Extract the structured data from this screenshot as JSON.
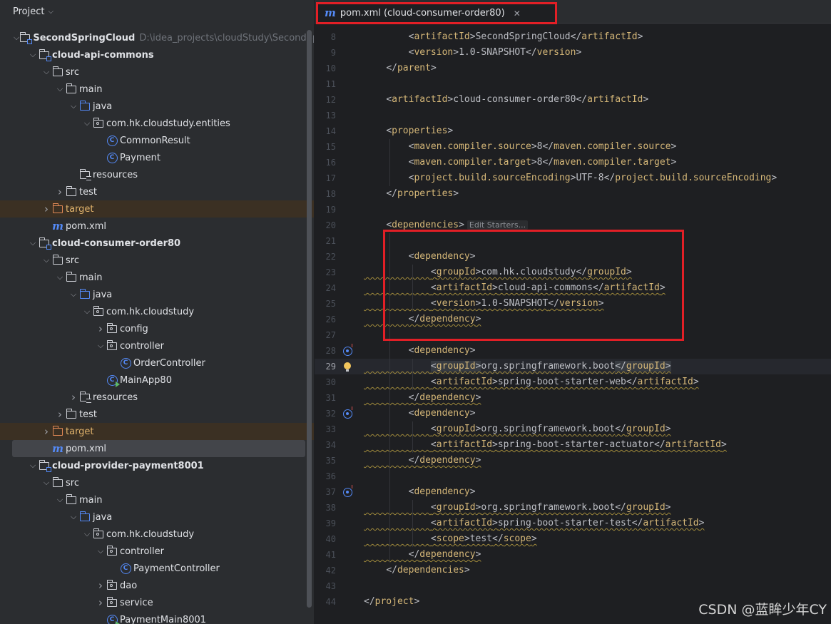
{
  "project_panel": {
    "title": "Project",
    "tree": [
      {
        "depth": 0,
        "arrow": "down",
        "icon": "module-folder-icon",
        "label": "SecondSpringCloud",
        "bold": true,
        "path": "D:\\idea_projects\\cloudStudy\\SecondSpringCloud"
      },
      {
        "depth": 1,
        "arrow": "down",
        "icon": "module-folder-icon",
        "label": "cloud-api-commons",
        "bold": true
      },
      {
        "depth": 2,
        "arrow": "down",
        "icon": "folder-icon",
        "label": "src"
      },
      {
        "depth": 3,
        "arrow": "down",
        "icon": "folder-icon",
        "label": "main"
      },
      {
        "depth": 4,
        "arrow": "down",
        "icon": "source-folder-icon",
        "label": "java"
      },
      {
        "depth": 5,
        "arrow": "down",
        "icon": "package-icon",
        "label": "com.hk.cloudstudy.entities"
      },
      {
        "depth": 6,
        "arrow": "none",
        "icon": "class-icon",
        "label": "CommonResult"
      },
      {
        "depth": 6,
        "arrow": "none",
        "icon": "class-icon",
        "label": "Payment"
      },
      {
        "depth": 4,
        "arrow": "none",
        "icon": "resources-folder-icon",
        "label": "resources"
      },
      {
        "depth": 3,
        "arrow": "right",
        "icon": "folder-icon",
        "label": "test"
      },
      {
        "depth": 2,
        "arrow": "right",
        "icon": "excluded-folder-icon",
        "label": "target",
        "highlight": "brown"
      },
      {
        "depth": 2,
        "arrow": "none",
        "icon": "maven-icon",
        "label": "pom.xml"
      },
      {
        "depth": 1,
        "arrow": "down",
        "icon": "module-folder-icon",
        "label": "cloud-consumer-order80",
        "bold": true
      },
      {
        "depth": 2,
        "arrow": "down",
        "icon": "folder-icon",
        "label": "src"
      },
      {
        "depth": 3,
        "arrow": "down",
        "icon": "folder-icon",
        "label": "main"
      },
      {
        "depth": 4,
        "arrow": "down",
        "icon": "source-folder-icon",
        "label": "java"
      },
      {
        "depth": 5,
        "arrow": "down",
        "icon": "package-icon",
        "label": "com.hk.cloudstudy"
      },
      {
        "depth": 6,
        "arrow": "right",
        "icon": "package-icon",
        "label": "config"
      },
      {
        "depth": 6,
        "arrow": "down",
        "icon": "package-icon",
        "label": "controller"
      },
      {
        "depth": 7,
        "arrow": "none",
        "icon": "class-icon",
        "label": "OrderController"
      },
      {
        "depth": 6,
        "arrow": "none",
        "icon": "spring-boot-class-icon",
        "label": "MainApp80"
      },
      {
        "depth": 4,
        "arrow": "right",
        "icon": "resources-folder-icon",
        "label": "resources"
      },
      {
        "depth": 3,
        "arrow": "right",
        "icon": "folder-icon",
        "label": "test"
      },
      {
        "depth": 2,
        "arrow": "right",
        "icon": "excluded-folder-icon",
        "label": "target",
        "highlight": "brown"
      },
      {
        "depth": 2,
        "arrow": "none",
        "icon": "maven-icon",
        "label": "pom.xml",
        "highlight": "gray"
      },
      {
        "depth": 1,
        "arrow": "down",
        "icon": "module-folder-icon",
        "label": "cloud-provider-payment8001",
        "bold": true
      },
      {
        "depth": 2,
        "arrow": "down",
        "icon": "folder-icon",
        "label": "src"
      },
      {
        "depth": 3,
        "arrow": "down",
        "icon": "folder-icon",
        "label": "main"
      },
      {
        "depth": 4,
        "arrow": "down",
        "icon": "source-folder-icon",
        "label": "java"
      },
      {
        "depth": 5,
        "arrow": "down",
        "icon": "package-icon",
        "label": "com.hk.cloudstudy"
      },
      {
        "depth": 6,
        "arrow": "down",
        "icon": "package-icon",
        "label": "controller"
      },
      {
        "depth": 7,
        "arrow": "none",
        "icon": "class-icon",
        "label": "PaymentController"
      },
      {
        "depth": 6,
        "arrow": "right",
        "icon": "package-icon",
        "label": "dao"
      },
      {
        "depth": 6,
        "arrow": "right",
        "icon": "package-icon",
        "label": "service"
      },
      {
        "depth": 6,
        "arrow": "none",
        "icon": "spring-boot-class-icon",
        "label": "PaymentMain8001"
      }
    ]
  },
  "editor": {
    "tab": {
      "icon": "maven-icon",
      "label": "pom.xml (cloud-consumer-order80)",
      "close_icon": "close-icon"
    },
    "current_line": 29,
    "lines": [
      {
        "n": 8,
        "indent": 2,
        "kind": "elem",
        "tag": "artifactId",
        "text": "SecondSpringCloud"
      },
      {
        "n": 9,
        "indent": 2,
        "kind": "elem",
        "tag": "version",
        "text": "1.0-SNAPSHOT"
      },
      {
        "n": 10,
        "indent": 1,
        "kind": "close",
        "tag": "parent"
      },
      {
        "n": 11,
        "kind": "blank"
      },
      {
        "n": 12,
        "indent": 1,
        "kind": "elem",
        "tag": "artifactId",
        "text": "cloud-consumer-order80"
      },
      {
        "n": 13,
        "kind": "blank"
      },
      {
        "n": 14,
        "indent": 1,
        "kind": "open",
        "tag": "properties"
      },
      {
        "n": 15,
        "indent": 2,
        "kind": "elem",
        "tag": "maven.compiler.source",
        "text": "8"
      },
      {
        "n": 16,
        "indent": 2,
        "kind": "elem",
        "tag": "maven.compiler.target",
        "text": "8"
      },
      {
        "n": 17,
        "indent": 2,
        "kind": "elem",
        "tag": "project.build.sourceEncoding",
        "text": "UTF-8"
      },
      {
        "n": 18,
        "indent": 1,
        "kind": "close",
        "tag": "properties"
      },
      {
        "n": 19,
        "kind": "blank"
      },
      {
        "n": 20,
        "indent": 1,
        "kind": "open",
        "tag": "dependencies",
        "hint": "Edit Starters..."
      },
      {
        "n": 21,
        "kind": "blank"
      },
      {
        "n": 22,
        "indent": 2,
        "kind": "open",
        "tag": "dependency"
      },
      {
        "n": 23,
        "indent": 3,
        "kind": "elem",
        "tag": "groupId",
        "text": "com.hk.cloudstudy",
        "wavy": true
      },
      {
        "n": 24,
        "indent": 3,
        "kind": "elem",
        "tag": "artifactId",
        "text": "cloud-api-commons",
        "wavy": true
      },
      {
        "n": 25,
        "indent": 3,
        "kind": "elem",
        "tag": "version",
        "text": "1.0-SNAPSHOT",
        "wavy": true
      },
      {
        "n": 26,
        "indent": 2,
        "kind": "close",
        "tag": "dependency",
        "wavy": true
      },
      {
        "n": 27,
        "kind": "blank"
      },
      {
        "n": 28,
        "indent": 2,
        "kind": "open",
        "tag": "dependency",
        "gutter": "override-icon"
      },
      {
        "n": 29,
        "indent": 3,
        "kind": "elem",
        "tag": "groupId",
        "text": "org.springframework.boot",
        "wavy": true,
        "gutter": "bulb-icon",
        "match": true
      },
      {
        "n": 30,
        "indent": 3,
        "kind": "elem",
        "tag": "artifactId",
        "text": "spring-boot-starter-web",
        "wavy": true
      },
      {
        "n": 31,
        "indent": 2,
        "kind": "close",
        "tag": "dependency",
        "wavy": true
      },
      {
        "n": 32,
        "indent": 2,
        "kind": "open",
        "tag": "dependency",
        "gutter": "override-icon"
      },
      {
        "n": 33,
        "indent": 3,
        "kind": "elem",
        "tag": "groupId",
        "text": "org.springframework.boot",
        "wavy": true
      },
      {
        "n": 34,
        "indent": 3,
        "kind": "elem",
        "tag": "artifactId",
        "text": "spring-boot-starter-actuator",
        "wavy": true
      },
      {
        "n": 35,
        "indent": 2,
        "kind": "close",
        "tag": "dependency",
        "wavy": true
      },
      {
        "n": 36,
        "kind": "blank"
      },
      {
        "n": 37,
        "indent": 2,
        "kind": "open",
        "tag": "dependency",
        "gutter": "override-icon"
      },
      {
        "n": 38,
        "indent": 3,
        "kind": "elem",
        "tag": "groupId",
        "text": "org.springframework.boot",
        "wavy": true
      },
      {
        "n": 39,
        "indent": 3,
        "kind": "elem",
        "tag": "artifactId",
        "text": "spring-boot-starter-test",
        "wavy": true
      },
      {
        "n": 40,
        "indent": 3,
        "kind": "elem",
        "tag": "scope",
        "text": "test",
        "wavy": true
      },
      {
        "n": 41,
        "indent": 2,
        "kind": "close",
        "tag": "dependency",
        "wavy": true
      },
      {
        "n": 42,
        "indent": 1,
        "kind": "close",
        "tag": "dependencies"
      },
      {
        "n": 43,
        "kind": "blank"
      },
      {
        "n": 44,
        "indent": 0,
        "kind": "close",
        "tag": "project"
      }
    ]
  },
  "watermark": "CSDN @蓝眸少年CY",
  "colors": {
    "highlight_box": "#e21f26",
    "xml_tag": "#d5b778",
    "text": "#bcbec4",
    "accent": "#548af7"
  }
}
